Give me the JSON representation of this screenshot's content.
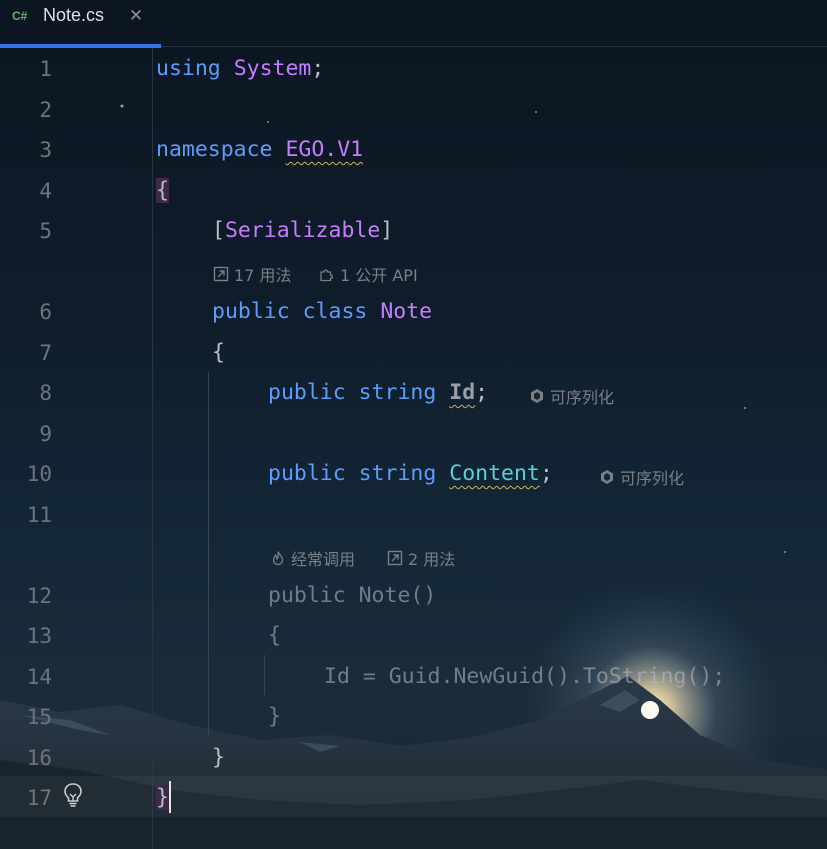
{
  "tab": {
    "lang": "C#",
    "title": "Note.cs",
    "close_icon": "close-icon"
  },
  "gutter": [
    "1",
    "2",
    "3",
    "4",
    "5",
    "6",
    "7",
    "8",
    "9",
    "10",
    "11",
    "12",
    "13",
    "14",
    "15",
    "16",
    "17"
  ],
  "code": {
    "l1_using": "using",
    "l1_system": "System",
    "l1_semi": ";",
    "l3_namespace": "namespace",
    "l3_ns": "EGO.V1",
    "l4_brace": "{",
    "l5_open": "[",
    "l5_attr": "Serializable",
    "l5_close": "]",
    "l6_public": "public",
    "l6_class": "class",
    "l6_name": "Note",
    "l7_brace": "{",
    "l8_public": "public",
    "l8_string": "string",
    "l8_field": "Id",
    "l8_semi": ";",
    "l10_public": "public",
    "l10_string": "string",
    "l10_field": "Content",
    "l10_semi": ";",
    "l12_ctor": "public Note()",
    "l13_brace": "{",
    "l14_stmt": "Id = Guid.NewGuid().ToString();",
    "l15_brace": "}",
    "l16_brace": "}",
    "l17_brace": "}"
  },
  "hints": {
    "class_usages": "17 用法",
    "class_api": "1 公开 API",
    "id_serializable": "可序列化",
    "content_serializable": "可序列化",
    "ctor_frequent": "经常调用",
    "ctor_usages": "2 用法"
  },
  "colors": {
    "keyword": "#5c9dfc",
    "type": "#c77dff",
    "field": "#5ad0d7",
    "accent": "#3574f0",
    "lang": "#5fb865"
  }
}
